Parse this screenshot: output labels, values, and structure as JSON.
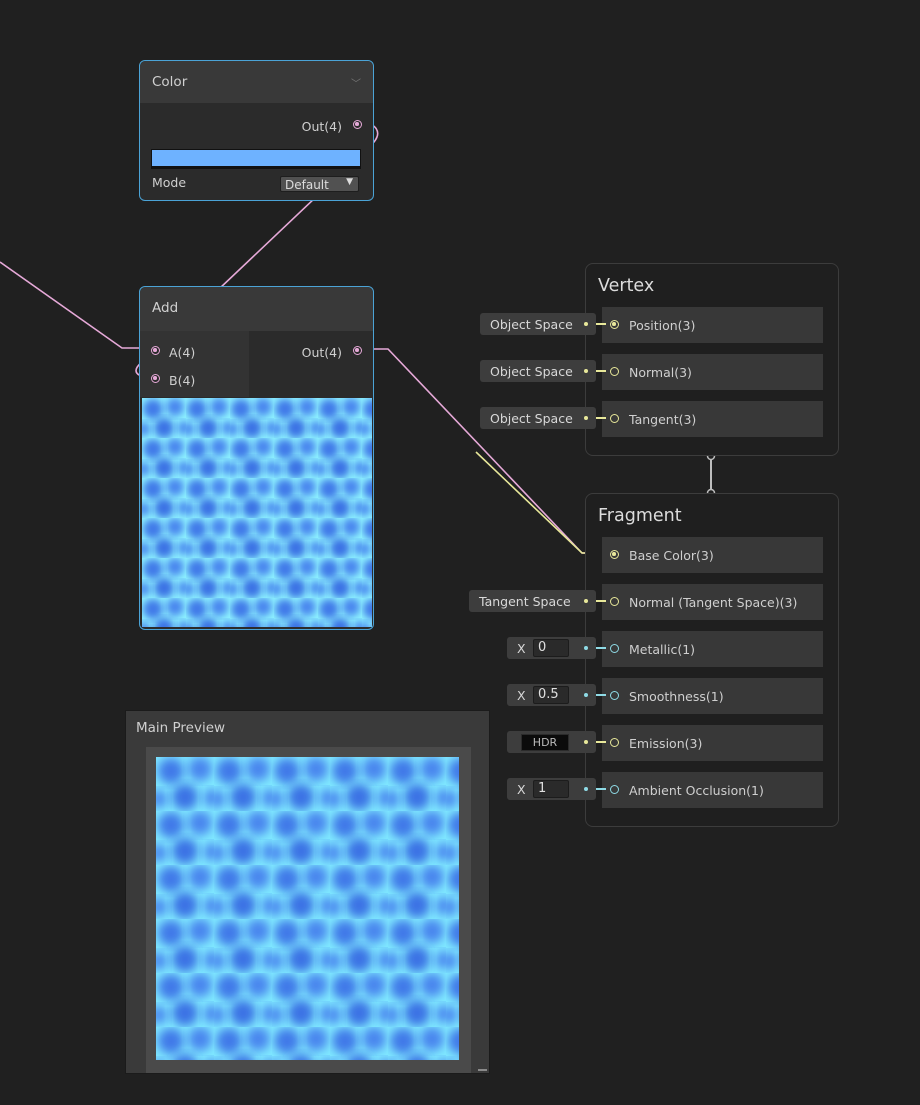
{
  "color_node": {
    "title": "Color",
    "out_label": "Out(4)",
    "swatch_color": "#6eb2ff",
    "mode_label": "Mode",
    "mode_value": "Default"
  },
  "add_node": {
    "title": "Add",
    "input_a": "A(4)",
    "input_b": "B(4)",
    "out_label": "Out(4)"
  },
  "vertex": {
    "title": "Vertex",
    "blocks": [
      {
        "label": "Position(3)",
        "input": "Object Space"
      },
      {
        "label": "Normal(3)",
        "input": "Object Space"
      },
      {
        "label": "Tangent(3)",
        "input": "Object Space"
      }
    ]
  },
  "fragment": {
    "title": "Fragment",
    "blocks": [
      {
        "label": "Base Color(3)"
      },
      {
        "label": "Normal (Tangent Space)(3)",
        "input": "Tangent Space"
      },
      {
        "label": "Metallic(1)",
        "axis": "X",
        "value": "0"
      },
      {
        "label": "Smoothness(1)",
        "axis": "X",
        "value": "0.5"
      },
      {
        "label": "Emission(3)",
        "input": "HDR"
      },
      {
        "label": "Ambient Occlusion(1)",
        "axis": "X",
        "value": "1"
      }
    ]
  },
  "main_preview": {
    "title": "Main Preview"
  },
  "colors": {
    "vector4": "#e6a9d8",
    "vector3": "#e8e89a",
    "float": "#8fdbe6",
    "selection": "#4ba3d6"
  },
  "icons": {
    "collapse": "chevron-down-icon",
    "dropdown": "caret-down-icon"
  }
}
